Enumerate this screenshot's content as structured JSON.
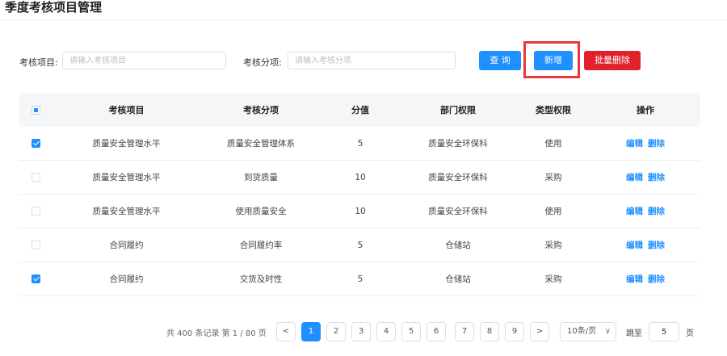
{
  "page": {
    "title": "季度考核项目管理"
  },
  "filters": {
    "item_label": "考核项目:",
    "item_placeholder": "请输入考核项目",
    "sub_label": "考核分项:",
    "sub_placeholder": "请输入考核分项"
  },
  "toolbar": {
    "query_label": "查 询",
    "add_label": "新增",
    "bulk_delete_label": "批量删除"
  },
  "table": {
    "headers": [
      "考核项目",
      "考核分项",
      "分值",
      "部门权限",
      "类型权限",
      "操作"
    ],
    "header_checkbox_state": "indeterminate",
    "rows": [
      {
        "checked": true,
        "item": "质量安全管理水平",
        "sub": "质量安全管理体系",
        "score": "5",
        "dept": "质量安全环保科",
        "type": "使用",
        "edit": "编辑",
        "delete": "删除"
      },
      {
        "checked": false,
        "item": "质量安全管理水平",
        "sub": "到货质量",
        "score": "10",
        "dept": "质量安全环保科",
        "type": "采购",
        "edit": "编辑",
        "delete": "删除"
      },
      {
        "checked": false,
        "item": "质量安全管理水平",
        "sub": "使用质量安全",
        "score": "10",
        "dept": "质量安全环保科",
        "type": "使用",
        "edit": "编辑",
        "delete": "删除"
      },
      {
        "checked": false,
        "item": "合同履约",
        "sub": "合同履约率",
        "score": "5",
        "dept": "仓储站",
        "type": "采购",
        "edit": "编辑",
        "delete": "删除"
      },
      {
        "checked": true,
        "item": "合同履约",
        "sub": "交货及时性",
        "score": "5",
        "dept": "仓储站",
        "type": "采购",
        "edit": "编辑",
        "delete": "删除"
      }
    ]
  },
  "pagination": {
    "total_text": "共 400 条记录 第 1 / 80 页",
    "prev": "<",
    "next": ">",
    "pages": [
      "1",
      "2",
      "3",
      "4",
      "5",
      "6",
      "7",
      "8",
      "9"
    ],
    "current_page": "1",
    "page_size": "10条/页",
    "goto_label": "跳至",
    "goto_value": "5",
    "page_suffix": "页"
  },
  "colors": {
    "primary": "#1e90ff",
    "danger": "#e0202a",
    "highlight": "#e8383d"
  }
}
